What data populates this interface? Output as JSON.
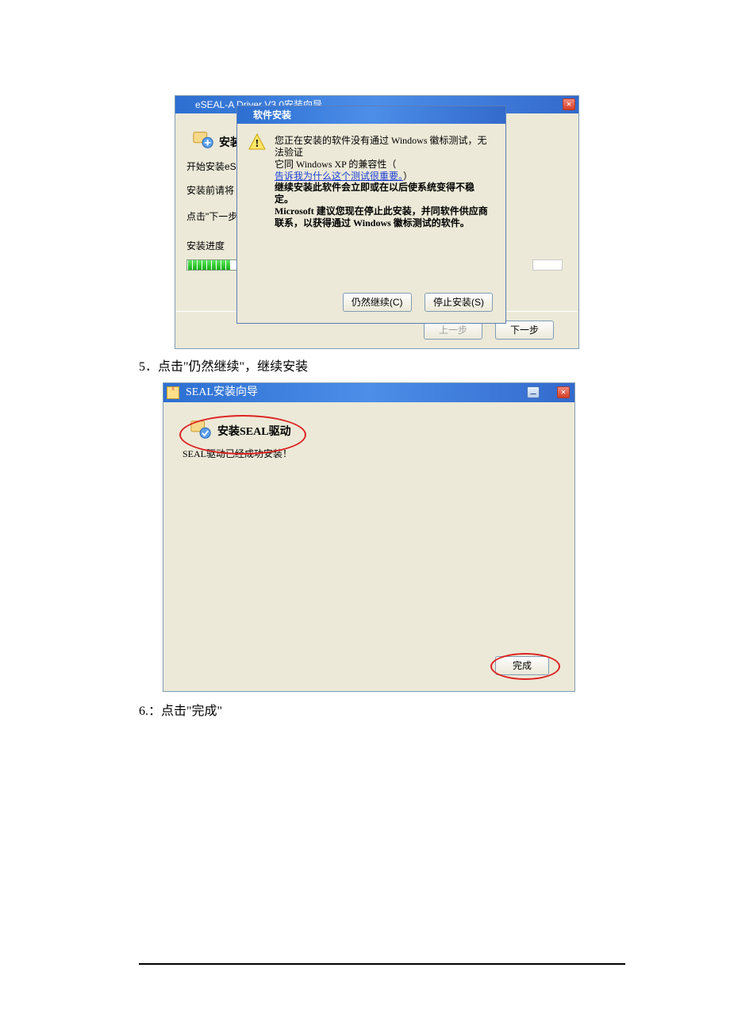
{
  "bgWindow": {
    "title": "eSEAL-A Driver V3.0安装向导",
    "headerLabel": "安装",
    "line_start": "开始安装eSE",
    "line_before": "安装前请将",
    "line_click": "点击\"下一步\"",
    "line_progress": "安装进度",
    "btn_prev": "上一步",
    "btn_next": "下一步"
  },
  "dialog": {
    "title": "软件安装",
    "paragraph_line1": "您正在安装的软件没有通过 Windows 徽标测试，无法验证",
    "paragraph_line2": "它同 Windows XP 的兼容性（",
    "link_text": "告诉我为什么这个测试很重要。",
    "link_close": "）",
    "bold_line1": "继续安装此软件会立即或在以后使系统变得不稳定。",
    "bold_line2": "Microsoft 建议您现在停止此安装，并同软件供应商",
    "bold_line3": "联系，以获得通过 Windows 徽标测试的软件。",
    "btn_continue": "仍然继续(C)",
    "btn_stop": "停止安装(S)"
  },
  "step5": "5．点击\"仍然继续\"，继续安装",
  "win2": {
    "title": "SEAL安装向导",
    "header": "安装SEAL驱动",
    "msg": "SEAL驱动已经成功安装！",
    "btn_finish": "完成"
  },
  "step6": "6.：点击\"完成\""
}
